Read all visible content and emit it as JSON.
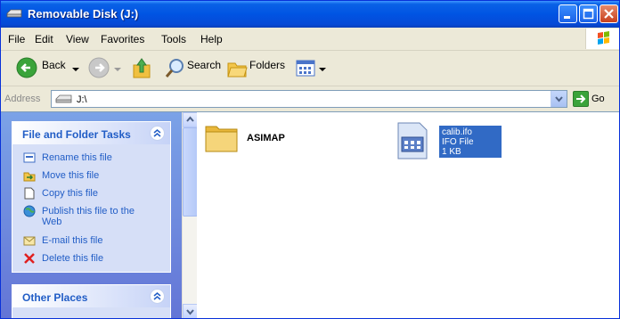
{
  "window": {
    "title": "Removable Disk (J:)",
    "accent": "#0054E3"
  },
  "menubar": {
    "items": [
      "File",
      "Edit",
      "View",
      "Favorites",
      "Tools",
      "Help"
    ]
  },
  "toolbar": {
    "back_label": "Back",
    "search_label": "Search",
    "folders_label": "Folders"
  },
  "address": {
    "label": "Address",
    "value": "J:\\",
    "go_label": "Go"
  },
  "tasks_panel": {
    "title": "File and Folder Tasks",
    "items": [
      {
        "label": "Rename this file",
        "icon": "rename-icon"
      },
      {
        "label": "Move this file",
        "icon": "move-icon"
      },
      {
        "label": "Copy this file",
        "icon": "copy-icon"
      },
      {
        "label": "Publish this file to the",
        "label2": "Web",
        "icon": "publish-web-icon"
      },
      {
        "label": "E-mail this file",
        "icon": "email-icon"
      },
      {
        "label": "Delete this file",
        "icon": "delete-icon"
      }
    ]
  },
  "other_places": {
    "title": "Other Places"
  },
  "files": [
    {
      "name": "ASIMAP",
      "type": "folder"
    },
    {
      "name": "calib.ifo",
      "type_label": "IFO File",
      "size": "1 KB",
      "selected": true
    }
  ]
}
